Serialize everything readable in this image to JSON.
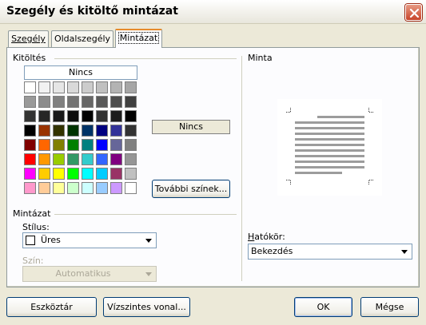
{
  "window": {
    "title": "Szegély és kitöltő mintázat"
  },
  "tabs": [
    {
      "label": "Szegély",
      "active": false
    },
    {
      "label": "Oldalszegély",
      "active": false
    },
    {
      "label": "Mintázat",
      "active": true
    }
  ],
  "fill": {
    "group_label": "Kitöltés",
    "no_color_label": "Nincs",
    "selected_label": "Nincs",
    "more_colors_label": "További színek...",
    "palette": [
      [
        "#FFFFFF",
        "#F2F2F2",
        "#E6E6E6",
        "#D9D9D9",
        "#CCCCCC",
        "#C0C0C0",
        "#B3B3B3",
        "#A6A6A6"
      ],
      [
        "#999999",
        "#8C8C8C",
        "#808080",
        "#737373",
        "#666666",
        "#595959",
        "#4D4D4D",
        "#404040"
      ],
      [
        "#333333",
        "#262626",
        "#1A1A1A",
        "#0D0D0D",
        "#000000",
        "#333333",
        "#1C1C1C",
        "#000000"
      ],
      [
        "#000000",
        "#993300",
        "#333300",
        "#003300",
        "#003366",
        "#000080",
        "#333399",
        "#333333"
      ],
      [
        "#800000",
        "#FF6600",
        "#808000",
        "#008000",
        "#008080",
        "#0000FF",
        "#666699",
        "#808080"
      ],
      [
        "#FF0000",
        "#FF9900",
        "#99CC00",
        "#339966",
        "#33CCCC",
        "#3366FF",
        "#800080",
        "#969696"
      ],
      [
        "#FF00FF",
        "#FFCC00",
        "#FFFF00",
        "#00FF00",
        "#00FFFF",
        "#00CCFF",
        "#993366",
        "#C0C0C0"
      ],
      [
        "#FF99CC",
        "#FFCC99",
        "#FFFF99",
        "#CCFFCC",
        "#CCFFFF",
        "#99CCFF",
        "#CC99FF",
        "#FFFFFF"
      ]
    ]
  },
  "pattern": {
    "group_label": "Mintázat",
    "style_label": "Stílus:",
    "style_value": "Üres",
    "color_label": "Szín:",
    "color_value": "Automatikus"
  },
  "preview": {
    "group_label": "Minta",
    "scope_label": "Hatókör:",
    "scope_value": "Bekezdés"
  },
  "buttons": {
    "toolbar": "Eszköztár",
    "horizontal_line": "Vízszintes vonal...",
    "ok": "OK",
    "cancel": "Mégse"
  },
  "icons": {
    "close": "close-icon",
    "dropdown": "chevron-down-icon"
  }
}
